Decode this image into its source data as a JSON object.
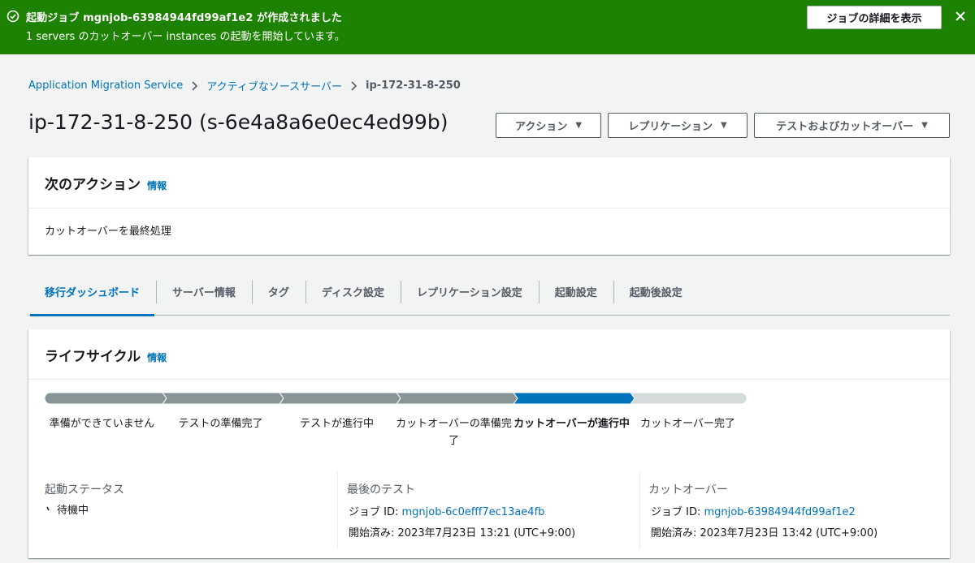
{
  "flash": {
    "title": "起動ジョブ mgnjob-63984944fd99af1e2 が作成されました",
    "message": "1 servers のカットオーバー instances の起動を開始しています。",
    "view_button": "ジョブの詳細を表示",
    "success_color": "#1d8102"
  },
  "breadcrumb": {
    "items": [
      "Application Migration Service",
      "アクティブなソースサーバー"
    ],
    "current": "ip-172-31-8-250"
  },
  "page": {
    "title": "ip-172-31-8-250 (s-6e4a8a6e0ec4ed99b)",
    "buttons": {
      "actions": "アクション",
      "replication": "レプリケーション",
      "test_cutover": "テストおよびカットオーバー"
    }
  },
  "next_action": {
    "title": "次のアクション",
    "info": "情報",
    "text": "カットオーバーを最終処理"
  },
  "tabs": [
    "移行ダッシュボード",
    "サーバー情報",
    "タグ",
    "ディスク設定",
    "レプリケーション設定",
    "起動設定",
    "起動後設定"
  ],
  "lifecycle": {
    "title": "ライフサイクル",
    "info": "情報",
    "steps": [
      {
        "label": "準備ができていません",
        "state": "done"
      },
      {
        "label": "テストの準備完了",
        "state": "done"
      },
      {
        "label": "テストが進行中",
        "state": "done"
      },
      {
        "label": "カットオーバーの準備完了",
        "state": "done"
      },
      {
        "label": "カットオーバーが進行中",
        "state": "current"
      },
      {
        "label": "カットオーバー完了",
        "state": "todo"
      }
    ],
    "colors": {
      "done": "#879596",
      "current": "#0073bb",
      "todo": "#d5dbdb"
    },
    "launch_status": {
      "title": "起動ステータス",
      "value": "待機中"
    },
    "last_test": {
      "title": "最後のテスト",
      "job_label": "ジョブ ID:",
      "job_id": "mgnjob-6c0efff7ec13ae4fb",
      "started_label": "開始済み:",
      "started": "2023年7月23日 13:21 (UTC+9:00)"
    },
    "cutover": {
      "title": "カットオーバー",
      "job_label": "ジョブ ID:",
      "job_id": "mgnjob-63984944fd99af1e2",
      "started_label": "開始済み:",
      "started": "2023年7月23日 13:42 (UTC+9:00)"
    }
  }
}
